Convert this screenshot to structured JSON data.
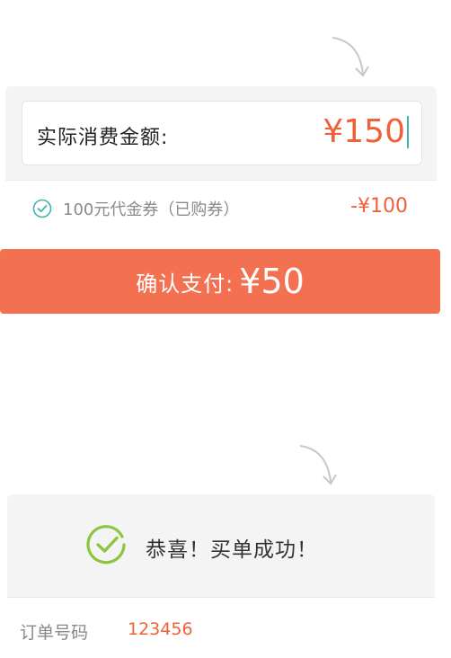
{
  "payment": {
    "amount_label": "实际消费金额:",
    "amount_value": "¥150",
    "coupon_text": "100元代金券（已购券）",
    "coupon_discount": "-¥100"
  },
  "confirm": {
    "label": "确认支付:",
    "amount": "¥50"
  },
  "success": {
    "message": "恭喜！买单成功！",
    "order_label": "订单号码",
    "order_number": "123456"
  },
  "colors": {
    "accent": "#f37150",
    "price": "#f0603a",
    "success_green": "#8cc63e",
    "coupon_teal": "#3fb3ae"
  }
}
